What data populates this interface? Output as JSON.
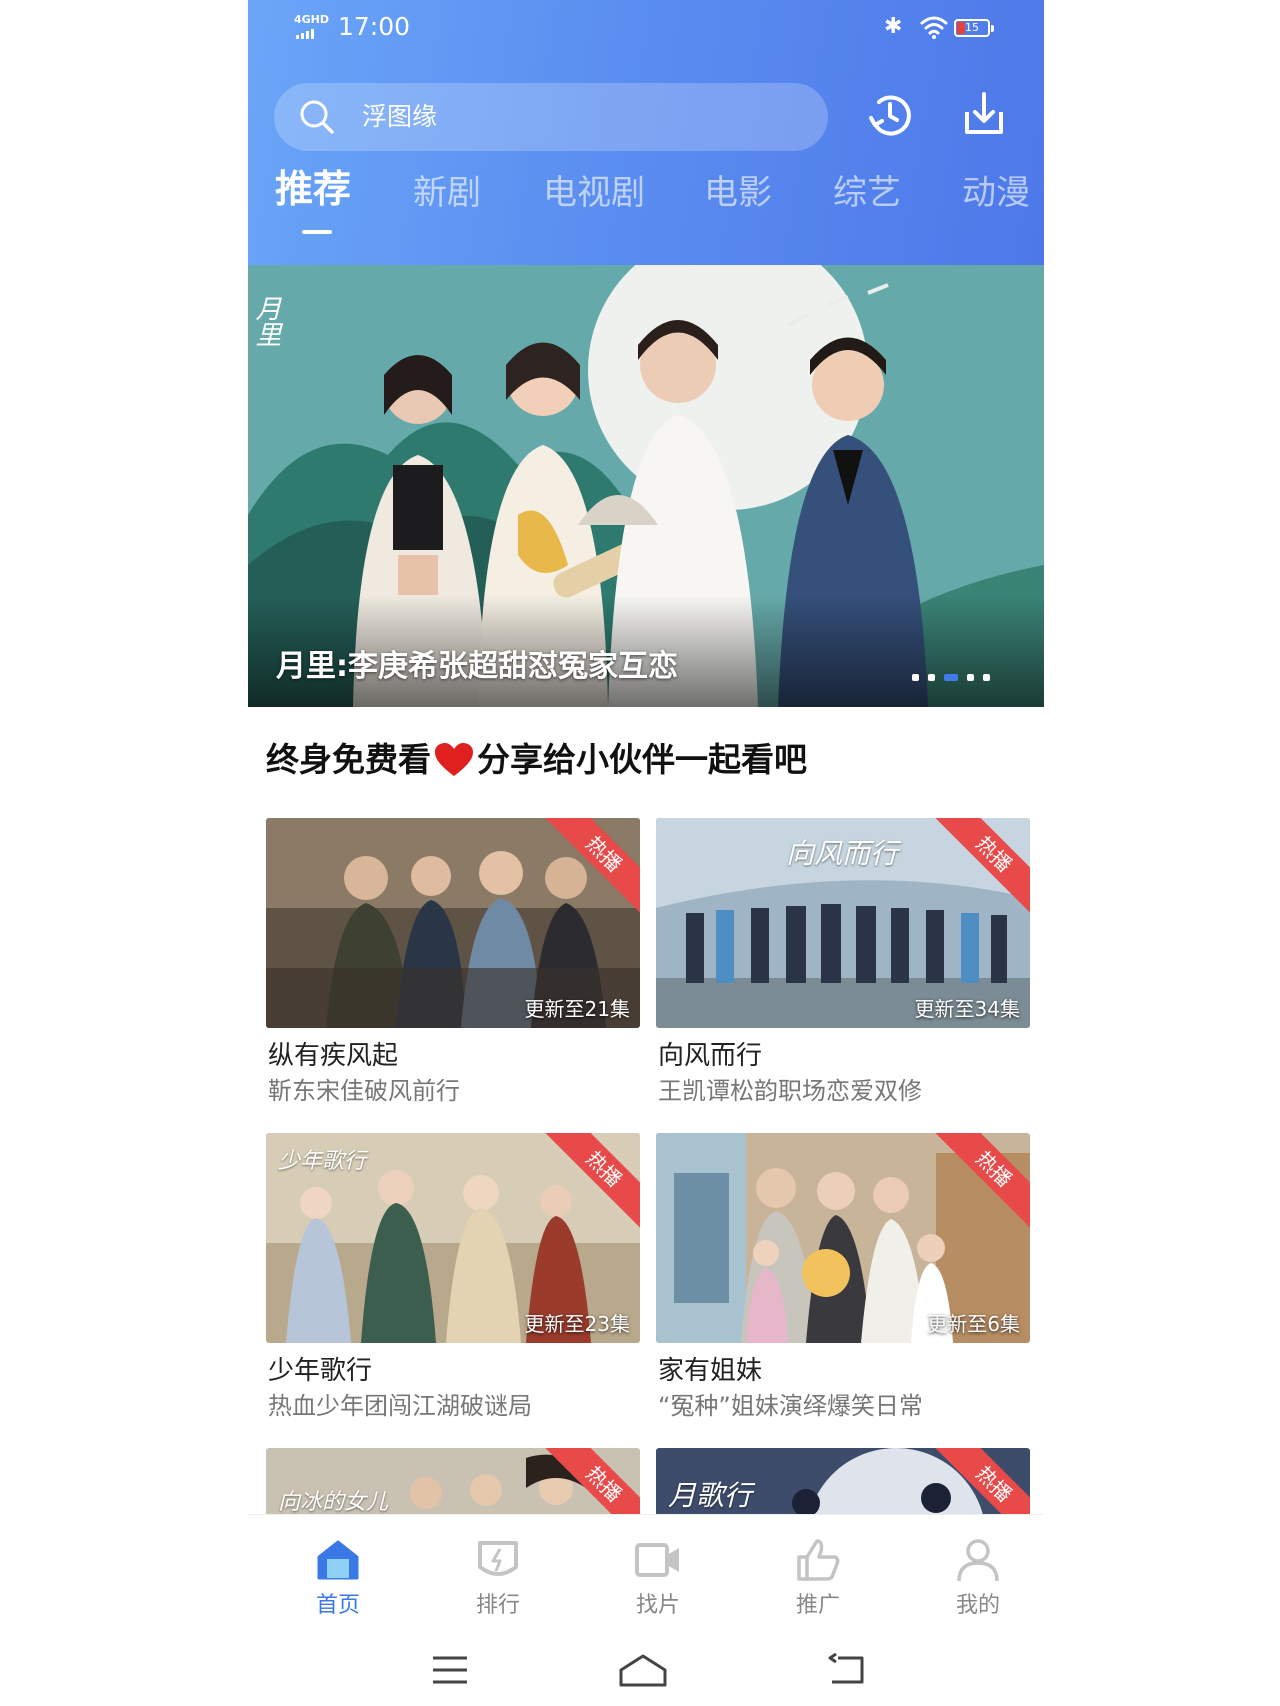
{
  "status_bar": {
    "network": "4GHD",
    "time": "17:00",
    "battery": "15"
  },
  "search": {
    "placeholder": "浮图缘"
  },
  "header_icons": [
    "history-icon",
    "download-icon"
  ],
  "tabs": [
    {
      "label": "推荐",
      "active": true
    },
    {
      "label": "新剧"
    },
    {
      "label": "电视剧"
    },
    {
      "label": "电影"
    },
    {
      "label": "综艺"
    },
    {
      "label": "动漫"
    }
  ],
  "banner": {
    "title": "月里:李庚希张超甜怼冤家互恋",
    "slide_count": 5,
    "active_slide": 3
  },
  "section": {
    "title_part1": "终身免费看",
    "title_part2": "分享给小伙伴一起看吧"
  },
  "cards": [
    {
      "title": "纵有疾风起",
      "subtitle": "靳东宋佳破风前行",
      "episode": "更新至21集",
      "badge": "热播"
    },
    {
      "title": "向风而行",
      "subtitle": "王凯谭松韵职场恋爱双修",
      "episode": "更新至34集",
      "badge": "热播",
      "poster_text": "向风而行"
    },
    {
      "title": "少年歌行",
      "subtitle": "热血少年团闯江湖破谜局",
      "episode": "更新至23集",
      "badge": "热播",
      "poster_text": "少年歌行"
    },
    {
      "title": "家有姐妹",
      "subtitle": "“冤种”姐妹演绎爆笑日常",
      "episode": "更新至6集",
      "badge": "热播"
    },
    {
      "badge": "热播",
      "poster_text": "向冰的女儿"
    },
    {
      "badge": "热播",
      "poster_text": "月歌行"
    }
  ],
  "bottom_nav": [
    {
      "label": "首页",
      "icon": "home-icon",
      "active": true
    },
    {
      "label": "排行",
      "icon": "ranking-icon"
    },
    {
      "label": "找片",
      "icon": "video-camera-icon"
    },
    {
      "label": "推广",
      "icon": "thumbs-up-icon"
    },
    {
      "label": "我的",
      "icon": "user-icon"
    }
  ],
  "colors": {
    "accent": "#3a78e6",
    "header_start": "#6aa6f8",
    "header_end": "#4d78e9",
    "badge": "#e84a4a"
  }
}
